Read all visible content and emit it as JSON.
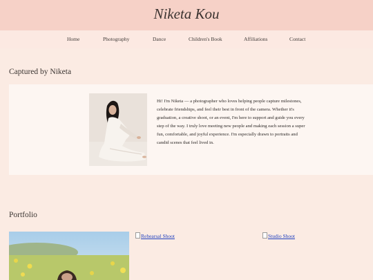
{
  "header": {
    "title": "Niketa Kou"
  },
  "nav": {
    "items": [
      "Home",
      "Photography",
      "Dance",
      "Children's Book",
      "Affiliations",
      "Contact"
    ]
  },
  "about": {
    "heading": "Captured by Niketa",
    "bio": "Hi! I'm Niketa — a photographer who loves helping people capture milestones, celebrate friendships, and feel their best in front of the camera. Whether it's graduation, a creative shoot, or an event, I'm here to support and guide you every step of the way. I truly love meeting new people and making each session a super fun, comfortable, and joyful experience. I'm especially drawn to portraits and candid scenes that feel lived in."
  },
  "portfolio": {
    "heading": "Portfolio",
    "items": [
      {
        "alt": ""
      },
      {
        "alt": "Rehearsal Shoot"
      },
      {
        "alt": "Studio Shoot"
      }
    ]
  },
  "colors": {
    "header_bg": "#f6d1c7",
    "page_bg": "#fbebe3",
    "card_bg": "#fdf6f2",
    "link": "#1f3fbf"
  }
}
